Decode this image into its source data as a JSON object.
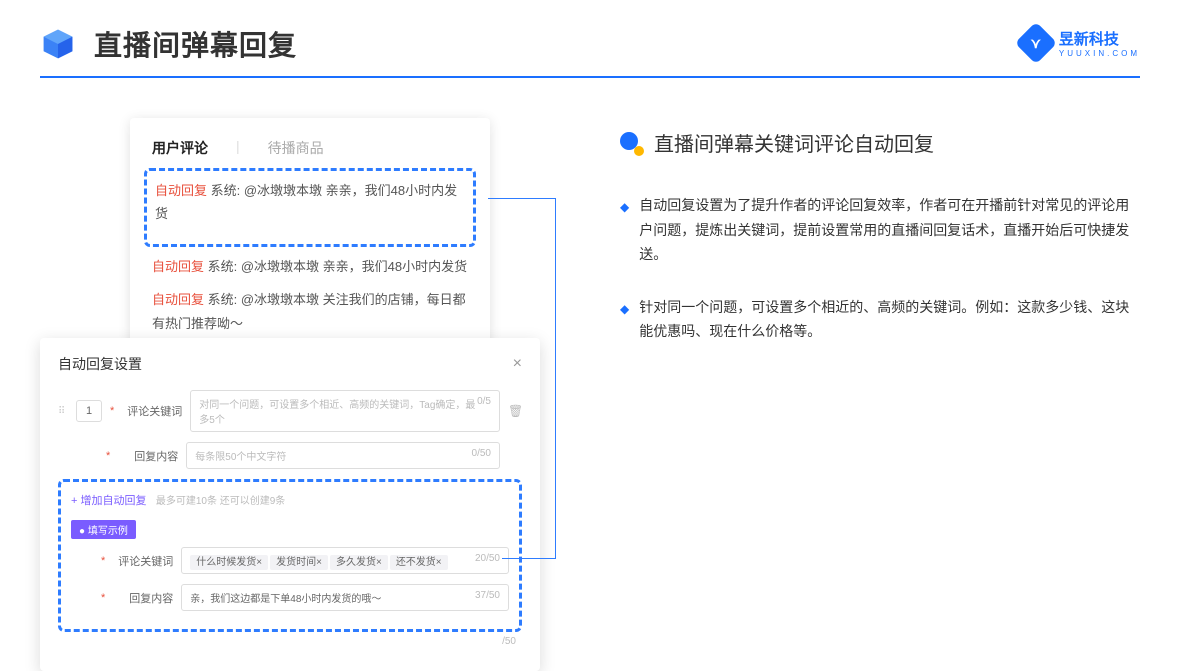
{
  "header": {
    "title": "直播间弹幕回复"
  },
  "brand": {
    "name": "昱新科技",
    "sub": "YUUXIN.COM",
    "letter": "⋎"
  },
  "cardA": {
    "tab1": "用户评论",
    "tab2": "待播商品",
    "c1_tag": "自动回复",
    "c1_rest": " 系统: @冰墩墩本墩 亲亲，我们48小时内发货",
    "c2_tag": "自动回复",
    "c2_rest": " 系统: @冰墩墩本墩 亲亲，我们48小时内发货",
    "c3_tag": "自动回复",
    "c3_rest": " 系统: @冰墩墩本墩 关注我们的店铺，每日都有热门推荐呦～"
  },
  "cardB": {
    "title": "自动回复设置",
    "num": "1",
    "row1_label": "评论关键词",
    "row1_ph": "对同一个问题，可设置多个相近、高频的关键词，Tag确定，最多5个",
    "row1_count": "0/5",
    "row2_label": "回复内容",
    "row2_ph": "每条限50个中文字符",
    "row2_count": "0/50",
    "add": "+ 增加自动回复",
    "add_hint": "最多可建10条 还可以创建9条",
    "badge": "● 填写示例",
    "ex1_label": "评论关键词",
    "ex1_tags": [
      "什么时候发货×",
      "发货时间×",
      "多久发货×",
      "还不发货×"
    ],
    "ex1_count": "20/50",
    "ex2_label": "回复内容",
    "ex2_val": "亲，我们这边都是下单48小时内发货的哦～",
    "ex2_count": "37/50",
    "tail_count": "/50"
  },
  "right": {
    "subtitle": "直播间弹幕关键词评论自动回复",
    "b1": "自动回复设置为了提升作者的评论回复效率，作者可在开播前针对常见的评论用户问题，提炼出关键词，提前设置常用的直播间回复话术，直播开始后可快捷发送。",
    "b2": "针对同一个问题，可设置多个相近的、高频的关键词。例如：这款多少钱、这块能优惠吗、现在什么价格等。"
  }
}
